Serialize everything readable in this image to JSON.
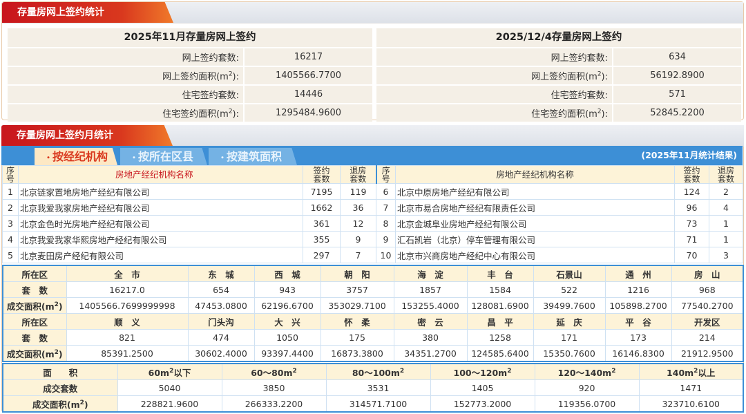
{
  "panel1": {
    "title": "存量房网上签约统计",
    "left": {
      "caption": "2025年11月存量房网上签约",
      "rows": [
        {
          "label": "网上签约套数:",
          "value": "16217"
        },
        {
          "label": "网上签约面积(m",
          "value": "1405566.7700"
        },
        {
          "label": "住宅签约套数:",
          "value": "14446"
        },
        {
          "label": "住宅签约面积(m",
          "value": "1295484.9600"
        }
      ]
    },
    "right": {
      "caption": "2025/12/4存量房网上签约",
      "rows": [
        {
          "label": "网上签约套数:",
          "value": "634"
        },
        {
          "label": "网上签约面积(m",
          "value": "56192.8900"
        },
        {
          "label": "住宅签约套数:",
          "value": "571"
        },
        {
          "label": "住宅签约面积(m",
          "value": "52845.2200"
        }
      ]
    },
    "sup": "2",
    "suffix": "):"
  },
  "panel2": {
    "title": "存量房网上签约月统计",
    "tabs": [
      "按经纪机构",
      "按所在区县",
      "按建筑面积"
    ],
    "result_note": "(2025年11月统计结果)",
    "agent_headers": {
      "no_1": "序",
      "no_2": "号",
      "name": "房地产经纪机构名称",
      "signed_1": "签约",
      "signed_2": "套数",
      "returned_1": "退房",
      "returned_2": "套数"
    },
    "agents_left": [
      {
        "no": "1",
        "name": "北京链家置地房地产经纪有限公司",
        "signed": "7195",
        "returned": "119"
      },
      {
        "no": "2",
        "name": "北京我爱我家房地产经纪有限公司",
        "signed": "1662",
        "returned": "36"
      },
      {
        "no": "3",
        "name": "北京金色时光房地产经纪有限公司",
        "signed": "361",
        "returned": "12"
      },
      {
        "no": "4",
        "name": "北京我爱我家华熙房地产经纪有限公司",
        "signed": "355",
        "returned": "9"
      },
      {
        "no": "5",
        "name": "北京麦田房产经纪有限公司",
        "signed": "297",
        "returned": "7"
      }
    ],
    "agents_right": [
      {
        "no": "6",
        "name": "北京中原房地产经纪有限公司",
        "signed": "124",
        "returned": "2"
      },
      {
        "no": "7",
        "name": "北京市易合房地产经纪有限责任公司",
        "signed": "96",
        "returned": "4"
      },
      {
        "no": "8",
        "name": "北京金城阜业房地产经纪有限公司",
        "signed": "73",
        "returned": "1"
      },
      {
        "no": "9",
        "name": "汇石凯岩（北京）停车管理有限公司",
        "signed": "71",
        "returned": "1"
      },
      {
        "no": "10",
        "name": "北京市兴商房地产经纪中心有限公司",
        "signed": "70",
        "returned": "3"
      }
    ],
    "district_labels": {
      "district": "所在区",
      "count": "套　数",
      "area": "成交面积(m",
      "sup": "2",
      "close": ")"
    },
    "districts_1": [
      {
        "name": "全　市",
        "count": "16217.0",
        "area": "1405566.7699999998"
      },
      {
        "name": "东　城",
        "count": "654",
        "area": "47453.0800"
      },
      {
        "name": "西　城",
        "count": "943",
        "area": "62196.6700"
      },
      {
        "name": "朝　阳",
        "count": "3757",
        "area": "353029.7100"
      },
      {
        "name": "海　淀",
        "count": "1857",
        "area": "153255.4000"
      },
      {
        "name": "丰　台",
        "count": "1584",
        "area": "128081.6900"
      },
      {
        "name": "石景山",
        "count": "522",
        "area": "39499.7600"
      },
      {
        "name": "通　州",
        "count": "1216",
        "area": "105898.2700"
      },
      {
        "name": "房　山",
        "count": "968",
        "area": "77540.2700"
      }
    ],
    "districts_2": [
      {
        "name": "顺　义",
        "count": "821",
        "area": "85391.2500"
      },
      {
        "name": "门头沟",
        "count": "474",
        "area": "30602.4000"
      },
      {
        "name": "大　兴",
        "count": "1050",
        "area": "93397.4400"
      },
      {
        "name": "怀　柔",
        "count": "175",
        "area": "16873.3800"
      },
      {
        "name": "密　云",
        "count": "380",
        "area": "34351.2700"
      },
      {
        "name": "昌　平",
        "count": "1258",
        "area": "124585.6400"
      },
      {
        "name": "延　庆",
        "count": "171",
        "area": "15350.7600"
      },
      {
        "name": "平　谷",
        "count": "173",
        "area": "16146.8300"
      },
      {
        "name": "开发区",
        "count": "214",
        "area": "21912.9500"
      }
    ],
    "area_labels": {
      "area": "面　　积",
      "count": "成交套数",
      "deal_area": "成交面积(m",
      "sup": "2",
      "close": ")"
    },
    "area_ranges": [
      {
        "pre": "60m",
        "sup": "2",
        "post": "以下",
        "count": "5040",
        "area": "228821.9600"
      },
      {
        "pre": "60～80m",
        "sup": "2",
        "post": "",
        "count": "3850",
        "area": "266333.2200"
      },
      {
        "pre": "80～100m",
        "sup": "2",
        "post": "",
        "count": "3531",
        "area": "314571.7100"
      },
      {
        "pre": "100～120m",
        "sup": "2",
        "post": "",
        "count": "1405",
        "area": "152773.2000"
      },
      {
        "pre": "120～140m",
        "sup": "2",
        "post": "",
        "count": "920",
        "area": "119356.0700"
      },
      {
        "pre": "140m",
        "sup": "2",
        "post": "以上",
        "count": "1471",
        "area": "323710.6100"
      }
    ]
  },
  "colors": {
    "brand_red": "#c8161d",
    "tab_blue": "#3d8fd6",
    "header_cream": "#fdf3d8",
    "cell_beige": "#f4efe6"
  },
  "icons": {
    "tab_bullet": "dot"
  }
}
